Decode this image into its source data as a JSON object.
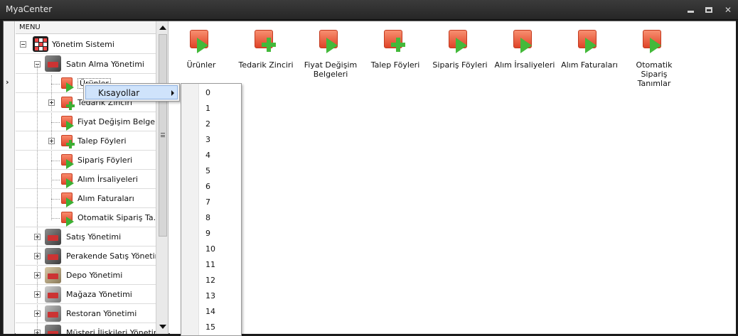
{
  "window": {
    "title": "MyaCenter"
  },
  "menu": {
    "header": "MENU",
    "root": {
      "label": "Yönetim Sistemi"
    },
    "satin_alma": {
      "label": "Satın Alma Yönetimi",
      "children": [
        {
          "label": "Ürünler",
          "icon": "play"
        },
        {
          "label": "Tedarik Zinciri",
          "icon": "plus"
        },
        {
          "label": "Fiyat Değişim Belgeleri",
          "icon": "play"
        },
        {
          "label": "Talep Föyleri",
          "icon": "plus"
        },
        {
          "label": "Sipariş Föyleri",
          "icon": "play"
        },
        {
          "label": "Alım İrsaliyeleri",
          "icon": "play"
        },
        {
          "label": "Alım Faturaları",
          "icon": "play"
        },
        {
          "label": "Otomatik Sipariş Ta...",
          "icon": "play"
        }
      ]
    },
    "modules": [
      {
        "label": "Satış Yönetimi"
      },
      {
        "label": "Perakende Satış Yönetimi"
      },
      {
        "label": "Depo Yönetimi"
      },
      {
        "label": "Mağaza Yönetimi"
      },
      {
        "label": "Restoran Yönetimi"
      },
      {
        "label": "Müşteri İlişkileri Yönetimi"
      }
    ]
  },
  "shortcuts": [
    {
      "line1": "Ürünler",
      "line2": "",
      "icon": "play"
    },
    {
      "line1": "Tedarik Zinciri",
      "line2": "",
      "icon": "plus"
    },
    {
      "line1": "Fiyat Değişim",
      "line2": "Belgeleri",
      "icon": "play"
    },
    {
      "line1": "Talep Föyleri",
      "line2": "",
      "icon": "plus"
    },
    {
      "line1": "Sipariş Föyleri",
      "line2": "",
      "icon": "play"
    },
    {
      "line1": "Alım İrsaliyeleri",
      "line2": "",
      "icon": "play"
    },
    {
      "line1": "Alım Faturaları",
      "line2": "",
      "icon": "play"
    },
    {
      "line1": "Otomatik Sipariş",
      "line2": "Tanımlar",
      "icon": "play"
    }
  ],
  "context_menu": {
    "item": "Kısayollar",
    "submenu": [
      "0",
      "1",
      "2",
      "3",
      "4",
      "5",
      "6",
      "7",
      "8",
      "9",
      "10",
      "11",
      "12",
      "13",
      "14",
      "15"
    ]
  }
}
